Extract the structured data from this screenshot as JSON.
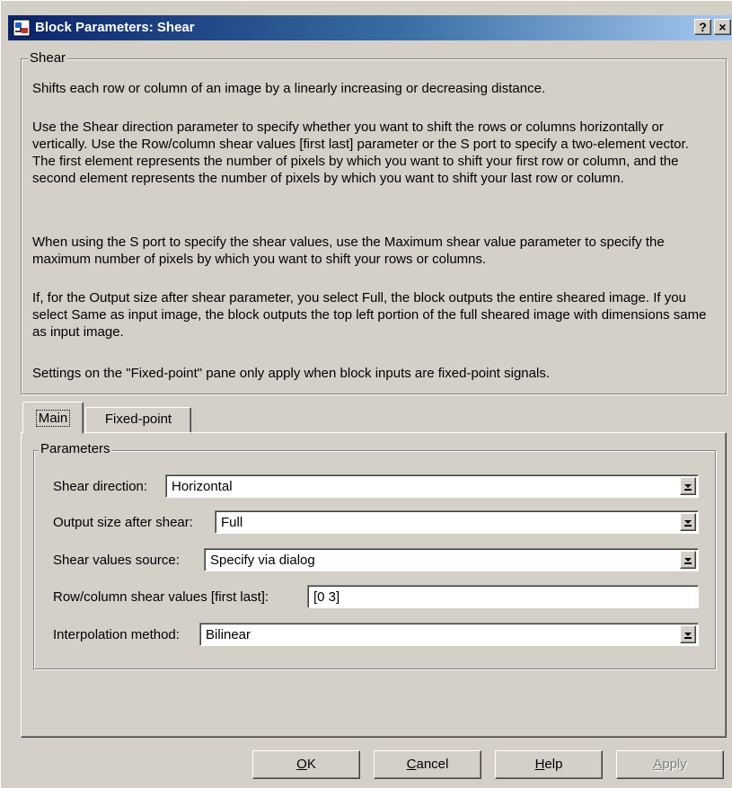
{
  "window": {
    "title": "Block Parameters: Shear",
    "help_glyph": "?",
    "close_glyph": "×"
  },
  "description": {
    "group_title": "Shear",
    "paragraphs": [
      "Shifts each row or column of an image by a linearly increasing or decreasing distance.",
      "Use the Shear direction parameter to specify whether you want to shift the rows or columns horizontally or vertically. Use the Row/column shear values [first last] parameter or the S port to specify a two-element vector. The first element represents the number of pixels by which you want to shift your first row or column, and the second element represents the number of pixels by which you want to shift your last row or column.",
      "When using the S port to specify the shear values, use the Maximum shear value parameter to specify the maximum number of pixels by which you want to shift your rows or columns.",
      "If, for the Output size after shear parameter, you select Full, the block outputs the entire sheared image. If you select Same as input image, the block outputs the top left portion of the full sheared image with dimensions same as input image.",
      "Settings on the \"Fixed-point\" pane only apply when block inputs are fixed-point signals."
    ]
  },
  "tabs": [
    {
      "label": "Main",
      "selected": true
    },
    {
      "label": "Fixed-point",
      "selected": false
    }
  ],
  "parameters": {
    "group_title": "Parameters",
    "shear_direction": {
      "label": "Shear direction:",
      "value": "Horizontal"
    },
    "output_size": {
      "label": "Output size after shear:",
      "value": "Full"
    },
    "shear_values_source": {
      "label": "Shear values source:",
      "value": "Specify via dialog"
    },
    "row_column_shear_values": {
      "label": "Row/column shear values [first last]:",
      "value": "[0 3]"
    },
    "interpolation_method": {
      "label": "Interpolation method:",
      "value": "Bilinear"
    }
  },
  "buttons": {
    "ok": {
      "label": "OK",
      "mnemonic": "O",
      "rest": "K"
    },
    "cancel": {
      "label": "Cancel",
      "mnemonic": "C",
      "rest": "ancel"
    },
    "help": {
      "label": "Help",
      "mnemonic": "H",
      "rest": "elp"
    },
    "apply": {
      "label": "Apply",
      "mnemonic": "A",
      "rest": "pply",
      "enabled": false
    }
  },
  "colors": {
    "titlebar_start": "#0a246a",
    "titlebar_end": "#a6caf0",
    "face": "#d4d0c8"
  }
}
